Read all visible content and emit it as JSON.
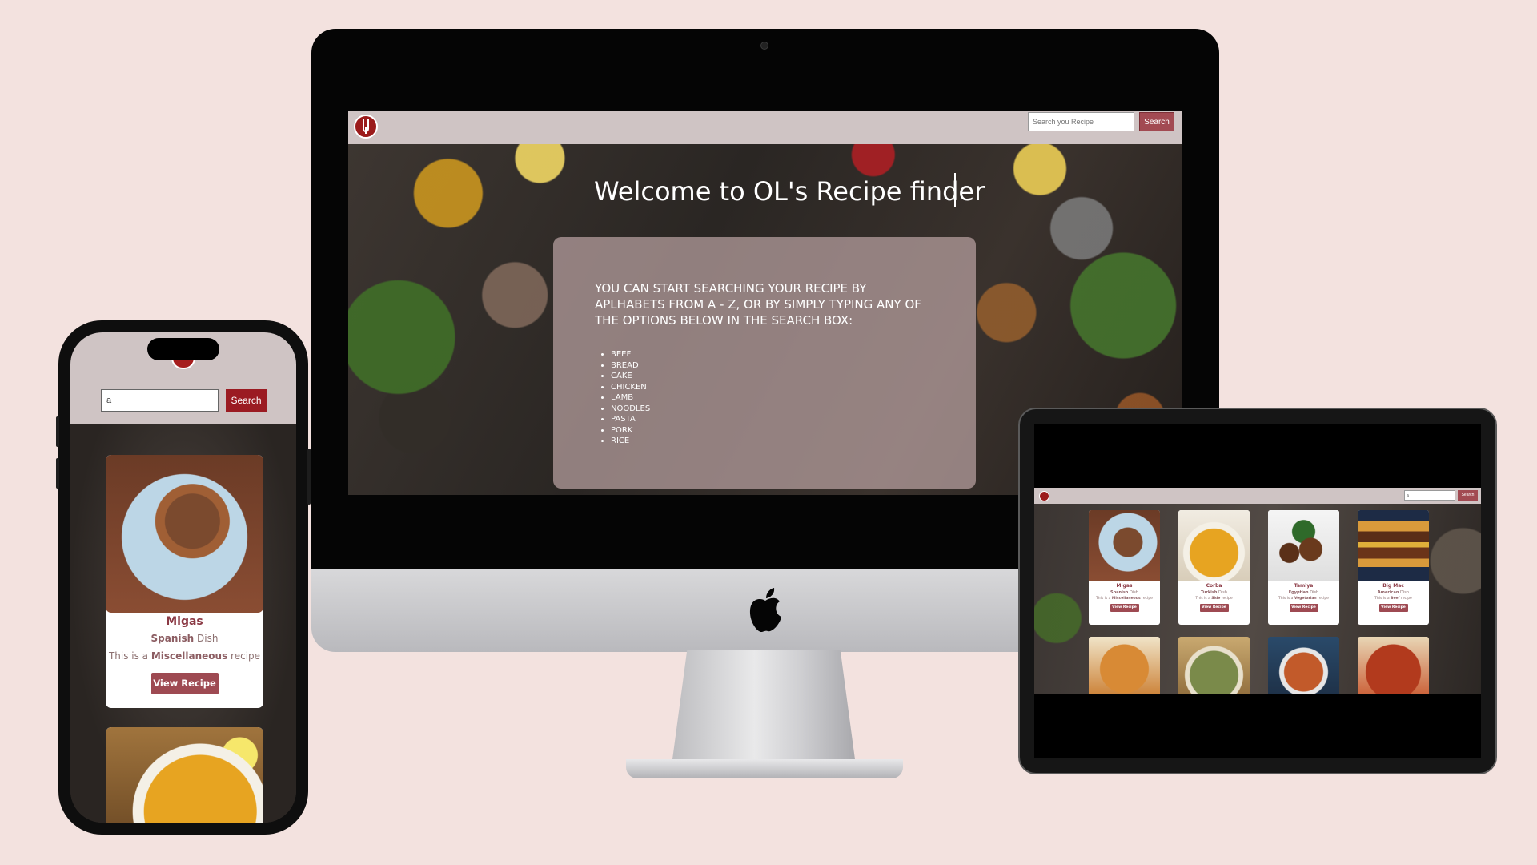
{
  "desktop": {
    "search": {
      "placeholder": "Search you Recipe",
      "button_label": "Search"
    },
    "hero": {
      "title": "Welcome to OL's Recipe finder",
      "instructions": "YOU CAN START SEARCHING YOUR RECIPE BY APLHABETS FROM A - Z, OR BY SIMPLY TYPING ANY OF THE OPTIONS BELOW IN THE SEARCH BOX:",
      "options": [
        "BEEF",
        "BREAD",
        "CAKE",
        "CHICKEN",
        "LAMB",
        "NOODLES",
        "PASTA",
        "PORK",
        "RICE"
      ]
    }
  },
  "phone": {
    "search": {
      "value": "a",
      "button_label": "Search"
    },
    "cards": [
      {
        "name": "Migas",
        "area": "Spanish",
        "area_suffix": " Dish",
        "desc_prefix": "This is a ",
        "category": "Miscellaneous",
        "desc_suffix": " recipe",
        "button": "View Recipe"
      }
    ]
  },
  "tablet": {
    "search": {
      "value": "a",
      "button_label": "Search"
    },
    "cards": [
      {
        "name": "Migas",
        "area": "Spanish",
        "area_suffix": " Dish",
        "desc_prefix": "This is a ",
        "category": "Miscellaneous",
        "desc_suffix": " recipe",
        "button": "View Recipe"
      },
      {
        "name": "Corba",
        "area": "Turkish",
        "area_suffix": " Dish",
        "desc_prefix": "This is a ",
        "category": "Side",
        "desc_suffix": " recipe",
        "button": "View Recipe"
      },
      {
        "name": "Tamiya",
        "area": "Egyptian",
        "area_suffix": " Dish",
        "desc_prefix": "This is a ",
        "category": "Vegetarian",
        "desc_suffix": " recipe",
        "button": "View Recipe"
      },
      {
        "name": "Big Mac",
        "area": "American",
        "area_suffix": " Dish",
        "desc_prefix": "This is a ",
        "category": "Beef",
        "desc_suffix": " recipe",
        "button": "View Recipe"
      }
    ]
  },
  "colors": {
    "accent": "#a24a52",
    "navbar": "#cfc4c4",
    "title": "#8b3a45",
    "background": "#f3e2df"
  },
  "icons": {
    "logo": "fork-plate-icon",
    "brand": "apple-logo-icon"
  }
}
